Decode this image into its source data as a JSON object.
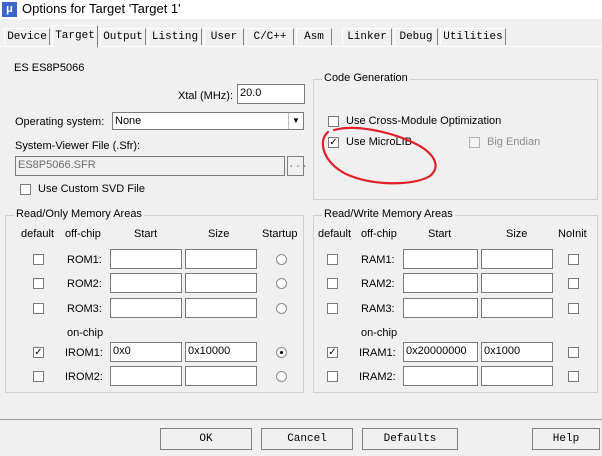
{
  "window": {
    "title": "Options for Target 'Target 1'",
    "icon": "μ"
  },
  "tabs": [
    "Device",
    "Target",
    "Output",
    "Listing",
    "User",
    "C/C++",
    "Asm",
    "Linker",
    "Debug",
    "Utilities"
  ],
  "device_name": "ES ES8P5066",
  "xtal": {
    "label": "Xtal (MHz):",
    "value": "20.0"
  },
  "os": {
    "label": "Operating system:",
    "value": "None"
  },
  "sysviewer": {
    "label": "System-Viewer File (.Sfr):",
    "value": "ES8P5066.SFR",
    "browse": "..."
  },
  "custom_svd": {
    "label": "Use Custom SVD File",
    "checked": false
  },
  "codegen": {
    "title": "Code Generation",
    "cross_module": {
      "label": "Use Cross-Module Optimization",
      "checked": false
    },
    "microlib": {
      "label": "Use MicroLIB",
      "checked": true
    },
    "big_endian": {
      "label": "Big Endian",
      "checked": false
    }
  },
  "ro": {
    "title": "Read/Only Memory Areas",
    "headers": {
      "default": "default",
      "offchip": "off-chip",
      "start": "Start",
      "size": "Size",
      "startup": "Startup"
    },
    "onchip_label": "on-chip",
    "rows": [
      {
        "name": "ROM1:",
        "start": "",
        "size": "",
        "default": false,
        "startup": false
      },
      {
        "name": "ROM2:",
        "start": "",
        "size": "",
        "default": false,
        "startup": false
      },
      {
        "name": "ROM3:",
        "start": "",
        "size": "",
        "default": false,
        "startup": false
      },
      {
        "name": "IROM1:",
        "start": "0x0",
        "size": "0x10000",
        "default": true,
        "startup": true
      },
      {
        "name": "IROM2:",
        "start": "",
        "size": "",
        "default": false,
        "startup": false
      }
    ]
  },
  "rw": {
    "title": "Read/Write Memory Areas",
    "headers": {
      "default": "default",
      "offchip": "off-chip",
      "start": "Start",
      "size": "Size",
      "noinit": "NoInit"
    },
    "onchip_label": "on-chip",
    "rows": [
      {
        "name": "RAM1:",
        "start": "",
        "size": "",
        "default": false,
        "noinit": false
      },
      {
        "name": "RAM2:",
        "start": "",
        "size": "",
        "default": false,
        "noinit": false
      },
      {
        "name": "RAM3:",
        "start": "",
        "size": "",
        "default": false,
        "noinit": false
      },
      {
        "name": "IRAM1:",
        "start": "0x20000000",
        "size": "0x1000",
        "default": true,
        "noinit": false
      },
      {
        "name": "IRAM2:",
        "start": "",
        "size": "",
        "default": false,
        "noinit": false
      }
    ]
  },
  "buttons": {
    "ok": "OK",
    "cancel": "Cancel",
    "defaults": "Defaults",
    "help": "Help"
  },
  "colors": {
    "annotation": "#e0202a",
    "title_icon": "#3a67c9"
  }
}
